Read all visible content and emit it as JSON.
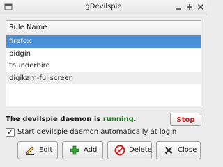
{
  "window": {
    "title": "gDevilspie",
    "menu_icon": "window-menu-icon",
    "minimize_icon": "minimize-icon",
    "maximize_icon": "maximize-icon",
    "close_icon": "close-icon"
  },
  "rules": {
    "column_header": "Rule Name",
    "items": [
      {
        "label": "firefox",
        "selected": true
      },
      {
        "label": "pidgin",
        "selected": false
      },
      {
        "label": "thunderbird",
        "selected": false
      },
      {
        "label": "digikam-fullscreen",
        "selected": false
      }
    ]
  },
  "status": {
    "prefix": "The devilspie daemon is ",
    "state": "running.",
    "state_color": "#1c7b1c",
    "stop_label": "Stop",
    "stop_color": "#cc1f1f"
  },
  "autostart": {
    "label": "Start devilspie daemon automatically at login",
    "checked": true
  },
  "buttons": {
    "edit": {
      "label": "Edit",
      "icon": "pencil-icon"
    },
    "add": {
      "label": "Add",
      "icon": "plus-icon"
    },
    "delete": {
      "label": "Delete",
      "icon": "no-entry-icon"
    },
    "close": {
      "label": "Close",
      "icon": "close-x-icon"
    }
  },
  "colors": {
    "selection": "#4a90d9",
    "add_icon": "#3aa33a",
    "delete_icon": "#cc1f1f"
  }
}
